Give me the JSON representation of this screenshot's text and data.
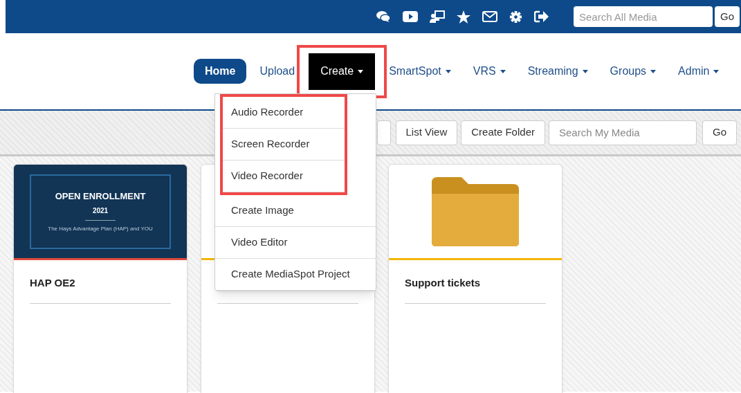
{
  "top_bar": {
    "search": {
      "placeholder": "Search All Media"
    },
    "go": "Go"
  },
  "nav": [
    {
      "label": "Home",
      "kind": "pill",
      "dropdown": false,
      "highlighted": false
    },
    {
      "label": "Upload",
      "kind": "link",
      "dropdown": false,
      "highlighted": false
    },
    {
      "label": "Create",
      "kind": "active",
      "dropdown": true,
      "highlighted": true
    },
    {
      "label": "SmartSpot",
      "kind": "link",
      "dropdown": true,
      "highlighted": false
    },
    {
      "label": "VRS",
      "kind": "link",
      "dropdown": true,
      "highlighted": false
    },
    {
      "label": "Streaming",
      "kind": "link",
      "dropdown": true,
      "highlighted": false
    },
    {
      "label": "Groups",
      "kind": "link",
      "dropdown": true,
      "highlighted": false
    },
    {
      "label": "Admin",
      "kind": "link",
      "dropdown": true,
      "highlighted": false
    }
  ],
  "create_menu": [
    {
      "label": "Audio Recorder",
      "highlighted": true
    },
    {
      "label": "Screen Recorder",
      "highlighted": true
    },
    {
      "label": "Video Recorder",
      "highlighted": true
    },
    {
      "label": "Create Image",
      "highlighted": false
    },
    {
      "label": "Video Editor",
      "highlighted": false
    },
    {
      "label": "Create MediaSpot Project",
      "highlighted": false
    }
  ],
  "toolbar": {
    "buttons": [
      "List View",
      "Create Folder"
    ],
    "search": {
      "placeholder": "Search My Media"
    },
    "go": "Go"
  },
  "cards": [
    {
      "kind": "slide",
      "title": "HAP OE2",
      "color": "#e0493a",
      "slide": {
        "heading": "OPEN ENROLLMENT",
        "year": "2021",
        "subtitle": "The Hays Advantage Plan (HAP) and YOU"
      }
    },
    {
      "kind": "blank",
      "color": "#f2b705"
    },
    {
      "kind": "folder",
      "title": "Support tickets",
      "color": "#f2b705"
    }
  ]
}
